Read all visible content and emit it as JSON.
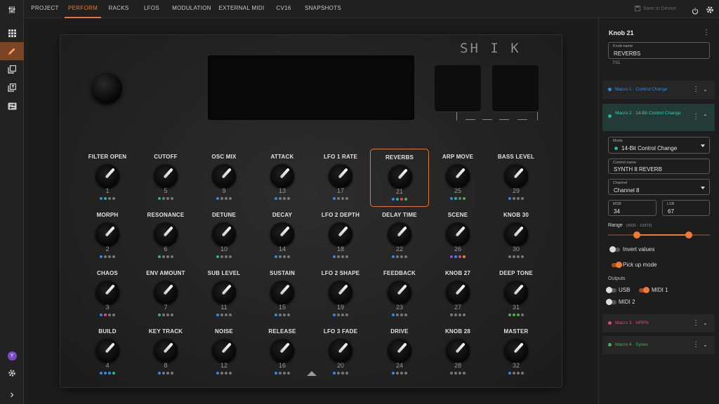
{
  "tabs": [
    "PROJECT",
    "PERFORM",
    "RACKS",
    "LFOS",
    "MODULATION",
    "EXTERNAL MIDI",
    "CV16",
    "SNAPSHOTS"
  ],
  "active_tab": "PERFORM",
  "save_label": "Save to Device",
  "rail": {
    "top_icon": "mixer-icon",
    "items": [
      "grid-icon",
      "pencil-icon",
      "copy-icon",
      "upload-icon",
      "transfer-icon"
    ],
    "active_item": "pencil-icon",
    "avatar": "Y",
    "settings_icon": "gear-icon",
    "expand_icon": "chevron-right-icon"
  },
  "device": {
    "logo": "SH I K",
    "knobs": [
      {
        "label": "FILTER OPEN",
        "num": "1",
        "dots": [
          "#2f8be6",
          "#1fb89a",
          "#777",
          "#777"
        ]
      },
      {
        "label": "CUTOFF",
        "num": "5",
        "dots": [
          "#1fb89a",
          "#777",
          "#777",
          "#777"
        ]
      },
      {
        "label": "OSC MIX",
        "num": "9",
        "dots": [
          "#2f8be6",
          "#777",
          "#777",
          "#777"
        ]
      },
      {
        "label": "ATTACK",
        "num": "13",
        "dots": [
          "#2f8be6",
          "#777",
          "#777",
          "#777"
        ]
      },
      {
        "label": "LFO 1 RATE",
        "num": "17",
        "dots": [
          "#2f8be6",
          "#777",
          "#777",
          "#777"
        ]
      },
      {
        "label": "REVERBS",
        "num": "21",
        "dots": [
          "#2f8be6",
          "#1fb89a",
          "#e0487a",
          "#4caf50"
        ]
      },
      {
        "label": "ARP MOVE",
        "num": "25",
        "dots": [
          "#2f8be6",
          "#1fb89a",
          "#777",
          "#4caf50"
        ]
      },
      {
        "label": "BASS LEVEL",
        "num": "29",
        "dots": [
          "#2f8be6",
          "#777",
          "#777",
          "#777"
        ]
      },
      {
        "label": "MORPH",
        "num": "2",
        "dots": [
          "#2f8be6",
          "#777",
          "#777",
          "#777"
        ]
      },
      {
        "label": "RESONANCE",
        "num": "6",
        "dots": [
          "#1fb89a",
          "#777",
          "#777",
          "#777"
        ]
      },
      {
        "label": "DETUNE",
        "num": "10",
        "dots": [
          "#1fb89a",
          "#777",
          "#777",
          "#777"
        ]
      },
      {
        "label": "DECAY",
        "num": "14",
        "dots": [
          "#2f8be6",
          "#777",
          "#777",
          "#777"
        ]
      },
      {
        "label": "LFO 2 DEPTH",
        "num": "18",
        "dots": [
          "#2f8be6",
          "#777",
          "#777",
          "#777"
        ]
      },
      {
        "label": "DELAY TIME",
        "num": "22",
        "dots": [
          "#2f8be6",
          "#777",
          "#777",
          "#777"
        ]
      },
      {
        "label": "SCENE",
        "num": "26",
        "dots": [
          "#8e44ff",
          "#2f8be6",
          "#e0487a",
          "#f07a38"
        ]
      },
      {
        "label": "KNOB 30",
        "num": "30",
        "dots": [
          "#777",
          "#777",
          "#777",
          "#777"
        ]
      },
      {
        "label": "CHAOS",
        "num": "3",
        "dots": [
          "#2f8be6",
          "#e0487a",
          "#777",
          "#777"
        ]
      },
      {
        "label": "ENV AMOUNT",
        "num": "7",
        "dots": [
          "#1fb89a",
          "#777",
          "#777",
          "#777"
        ]
      },
      {
        "label": "SUB LEVEL",
        "num": "11",
        "dots": [
          "#2f8be6",
          "#777",
          "#777",
          "#777"
        ]
      },
      {
        "label": "SUSTAIN",
        "num": "15",
        "dots": [
          "#2f8be6",
          "#777",
          "#777",
          "#777"
        ]
      },
      {
        "label": "LFO 2 SHAPE",
        "num": "19",
        "dots": [
          "#2f8be6",
          "#777",
          "#777",
          "#777"
        ]
      },
      {
        "label": "FEEDBACK",
        "num": "23",
        "dots": [
          "#2f8be6",
          "#777",
          "#777",
          "#777"
        ]
      },
      {
        "label": "KNOB 27",
        "num": "27",
        "dots": [
          "#777",
          "#777",
          "#777",
          "#777"
        ]
      },
      {
        "label": "DEEP TONE",
        "num": "31",
        "dots": [
          "#4caf50",
          "#4caf50",
          "#4caf50",
          "#777"
        ]
      },
      {
        "label": "BUILD",
        "num": "4",
        "dots": [
          "#2f8be6",
          "#2f8be6",
          "#2f8be6",
          "#1fb89a"
        ]
      },
      {
        "label": "KEY TRACK",
        "num": "8",
        "dots": [
          "#2f8be6",
          "#777",
          "#777",
          "#777"
        ]
      },
      {
        "label": "NOISE",
        "num": "12",
        "dots": [
          "#2f8be6",
          "#777",
          "#777",
          "#777"
        ]
      },
      {
        "label": "RELEASE",
        "num": "16",
        "dots": [
          "#2f8be6",
          "#777",
          "#777",
          "#777"
        ]
      },
      {
        "label": "LFO 3 FADE",
        "num": "20",
        "dots": [
          "#2f8be6",
          "#777",
          "#777",
          "#777"
        ]
      },
      {
        "label": "DRIVE",
        "num": "24",
        "dots": [
          "#2f8be6",
          "#777",
          "#777",
          "#777"
        ]
      },
      {
        "label": "KNOB 28",
        "num": "28",
        "dots": [
          "#777",
          "#777",
          "#777",
          "#777"
        ]
      },
      {
        "label": "MASTER",
        "num": "32",
        "dots": [
          "#2f8be6",
          "#777",
          "#777",
          "#777"
        ]
      }
    ],
    "selected_knob": "REVERBS"
  },
  "panel": {
    "title": "Knob 21",
    "knob_name_label": "Knob name",
    "knob_name_value": "REVERBS",
    "char_count": "7/11",
    "macro1": {
      "label": "Macro 1 · Control Change",
      "color": "#2f8be6"
    },
    "macro2": {
      "label": "Macro 2 · 14-Bit Control Change",
      "color": "#1fb89a",
      "mode_label": "Mode",
      "mode_value": "14-Bit Control Change",
      "control_name_label": "Control name",
      "control_name_value": "SYNTH 8 REVERB",
      "channel_label": "Channel",
      "channel_value": "Channel 8",
      "msb_label": "MSB",
      "msb_value": "34",
      "lsb_label": "LSB",
      "lsb_value": "67",
      "range_label": "Range",
      "range_hint": "(4331 - 13372)",
      "range_min": 4331,
      "range_max": 13372,
      "range_total": 16383,
      "invert_label": "Invert values",
      "invert_on": false,
      "pickup_label": "Pick up mode",
      "pickup_on": true,
      "outputs_label": "Outputs",
      "usb_label": "USB",
      "usb_on": false,
      "midi1_label": "MIDI 1",
      "midi1_on": true,
      "midi2_label": "MIDI 2",
      "midi2_on": false
    },
    "macro3": {
      "label": "Macro 3 · NRPN",
      "color": "#e0487a"
    },
    "macro4": {
      "label": "Macro 4 · Sysex",
      "color": "#4caf50"
    }
  }
}
